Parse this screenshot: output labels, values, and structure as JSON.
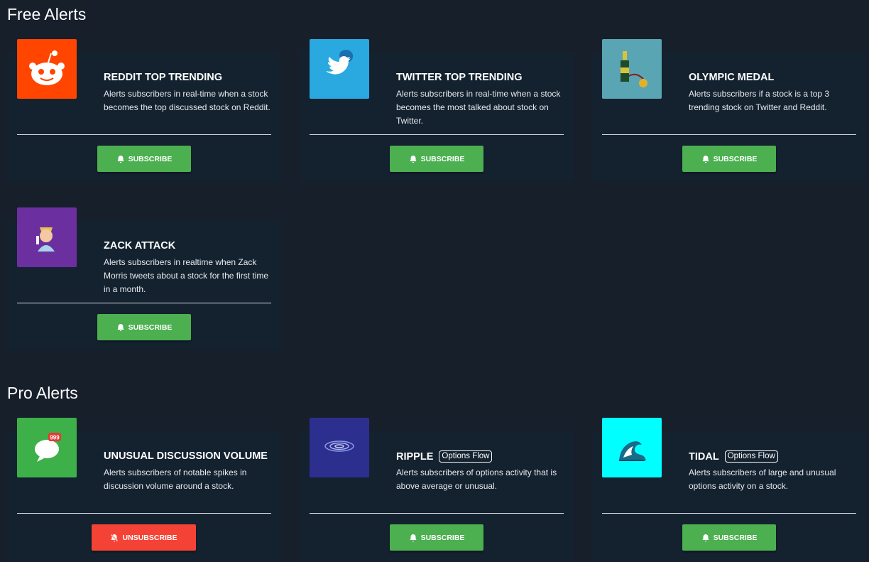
{
  "sections": {
    "free_title": "Free Alerts",
    "pro_title": "Pro Alerts"
  },
  "alerts": [
    {
      "title": "REDDIT TOP TRENDING",
      "description": "Alerts subscribers in real-time when a stock becomes the top discussed stock on Reddit.",
      "button": "SUBSCRIBE",
      "icon": "reddit-alien-icon",
      "thumb_color": "#ff4500"
    },
    {
      "title": "TWITTER TOP TRENDING",
      "description": "Alerts subscribers in real-time when a stock becomes the most talked about stock on Twitter.",
      "button": "SUBSCRIBE",
      "icon": "twitter-bird-icon",
      "thumb_color": "#2aa9e0"
    },
    {
      "title": "OLYMPIC MEDAL",
      "description": "Alerts subscribers if a stock is a top 3 trending stock on Twitter and Reddit.",
      "button": "SUBSCRIBE",
      "icon": "champagne-medal-icon",
      "thumb_color": "#5aa5b3"
    },
    {
      "title": "ZACK ATTACK",
      "description": "Alerts subscribers in realtime when Zack Morris tweets about a stock for the first time in a month.",
      "button": "SUBSCRIBE",
      "icon": "zack-character-icon",
      "thumb_color": "#6b2fa0"
    },
    {
      "title": "UNUSUAL DISCUSSION VOLUME",
      "description": "Alerts subscribers of notable spikes in discussion volume around a stock.",
      "button": "UNSUBSCRIBE",
      "icon": "chat-bubble-999-icon",
      "badge_text": "999",
      "thumb_color": "#3db04a"
    },
    {
      "title": "RIPPLE",
      "badge": "Options Flow",
      "description": "Alerts subscribers of options activity that is above average or unusual.",
      "button": "SUBSCRIBE",
      "icon": "water-ripple-icon",
      "thumb_color": "#2d2f8f"
    },
    {
      "title": "TIDAL",
      "badge": "Options Flow",
      "description": "Alerts subscribers of large and unusual options activity on a stock.",
      "button": "SUBSCRIBE",
      "icon": "tidal-wave-icon",
      "thumb_color": "#00ffff"
    }
  ],
  "colors": {
    "background": "#171f2b",
    "card": "#142230",
    "subscribe": "#4caf50",
    "unsubscribe": "#f44336"
  }
}
